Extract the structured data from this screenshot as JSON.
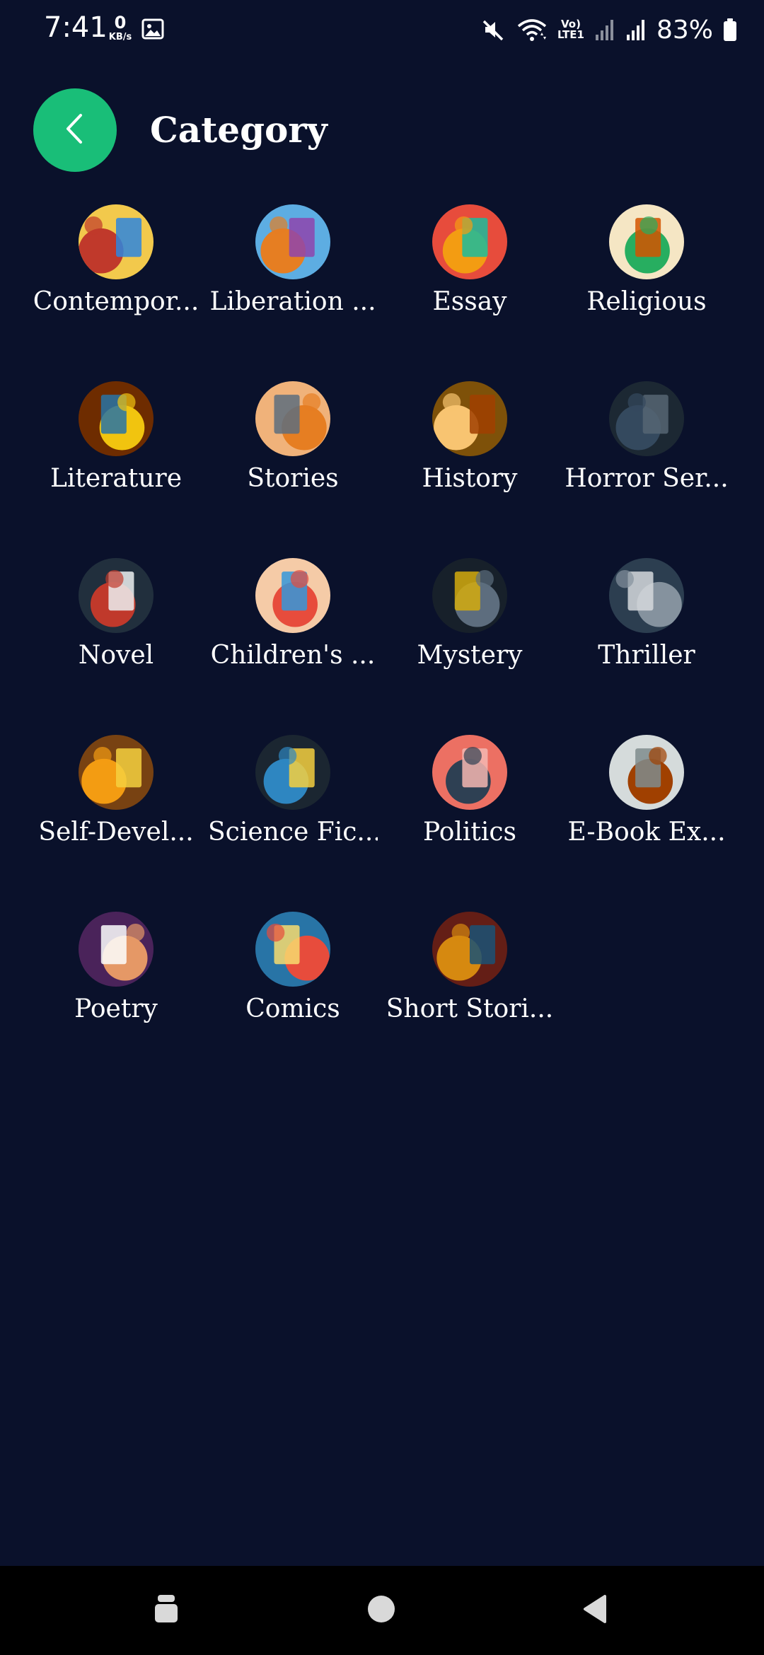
{
  "status_bar": {
    "time": "7:41",
    "net_speed_value": "0",
    "net_speed_unit": "KB/s",
    "volte_line1": "Vo)",
    "volte_line2": "LTE1",
    "battery_percent": "83%",
    "icons": [
      "gallery-icon",
      "mute-icon",
      "wifi-icon",
      "signal-icon",
      "signal-icon",
      "battery-icon"
    ]
  },
  "header": {
    "title": "Category",
    "back_icon": "chevron-left-icon"
  },
  "colors": {
    "background": "#0a112b",
    "accent": "#19be78",
    "text": "#ffffff",
    "nav_bar": "#000000"
  },
  "categories": [
    {
      "label": "Contempor...",
      "palette": [
        "#f2c94c",
        "#c0392b",
        "#2e86de"
      ]
    },
    {
      "label": "Liberation ...",
      "palette": [
        "#5dade2",
        "#e67e22",
        "#8e44ad"
      ]
    },
    {
      "label": "Essay",
      "palette": [
        "#e74c3c",
        "#f39c12",
        "#1abc9c"
      ]
    },
    {
      "label": "Religious",
      "palette": [
        "#f5e6c4",
        "#27ae60",
        "#d35400"
      ]
    },
    {
      "label": "Literature",
      "palette": [
        "#6e2c00",
        "#f1c40f",
        "#2874a6"
      ]
    },
    {
      "label": "Stories",
      "palette": [
        "#f0b27a",
        "#e67e22",
        "#5d6d7e"
      ]
    },
    {
      "label": "History",
      "palette": [
        "#7e5109",
        "#f8c471",
        "#a04000"
      ]
    },
    {
      "label": "Horror Ser...",
      "palette": [
        "#1c2833",
        "#34495e",
        "#566573"
      ]
    },
    {
      "label": "Novel",
      "palette": [
        "#212f3d",
        "#c0392b",
        "#ecf0f1"
      ]
    },
    {
      "label": "Children's ...",
      "palette": [
        "#f5cba7",
        "#e74c3c",
        "#3498db"
      ]
    },
    {
      "label": "Mystery",
      "palette": [
        "#17202a",
        "#5d6d7e",
        "#d4ac0d"
      ]
    },
    {
      "label": "Thriller",
      "palette": [
        "#2c3e50",
        "#85929e",
        "#d5d8dc"
      ]
    },
    {
      "label": "Self-Devel...",
      "palette": [
        "#784212",
        "#f39c12",
        "#f4d03f"
      ]
    },
    {
      "label": "Science Fic...",
      "palette": [
        "#1b2631",
        "#2e86c1",
        "#f4d03f"
      ]
    },
    {
      "label": "Politics",
      "palette": [
        "#ec7063",
        "#2e4053",
        "#f5b7b1"
      ]
    },
    {
      "label": "E-Book Ex...",
      "palette": [
        "#d5dbdb",
        "#a04000",
        "#7f8c8d"
      ]
    },
    {
      "label": "Poetry",
      "palette": [
        "#4a235a",
        "#e59866",
        "#fdfefe"
      ]
    },
    {
      "label": "Comics",
      "palette": [
        "#2874a6",
        "#e74c3c",
        "#f7dc6f"
      ]
    },
    {
      "label": "Short Stori...",
      "palette": [
        "#641e16",
        "#d68910",
        "#1a5276"
      ]
    }
  ],
  "nav_bar": {
    "icons": [
      "recents-icon",
      "home-icon",
      "back-icon"
    ]
  }
}
